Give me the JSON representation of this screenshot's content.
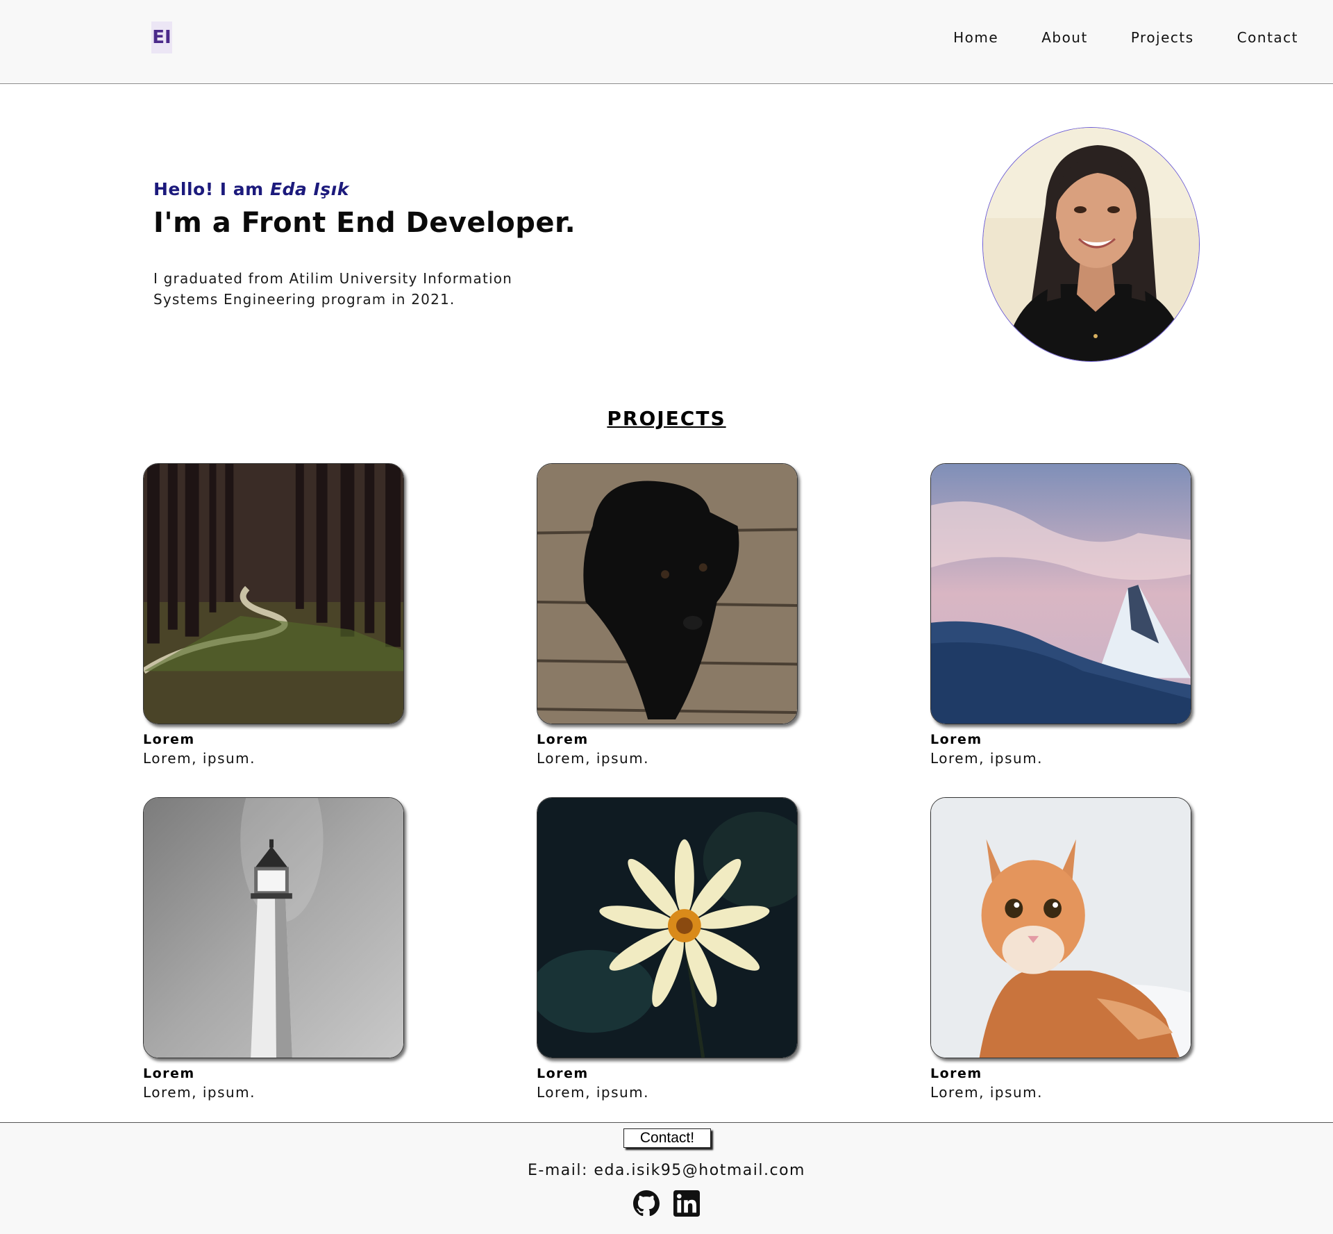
{
  "header": {
    "logo": "EI",
    "nav": [
      "Home",
      "About",
      "Projects",
      "Contact"
    ]
  },
  "hero": {
    "hello_prefix": "Hello! I am ",
    "name": "Eda Işık",
    "role": "I'm a Front End Developer.",
    "bio": "I graduated from Atilim University Information Systems Engineering program in 2021."
  },
  "projects": {
    "title": "PROJECTS",
    "items": [
      {
        "title": "Lorem",
        "desc": "Lorem, ipsum."
      },
      {
        "title": "Lorem",
        "desc": "Lorem, ipsum."
      },
      {
        "title": "Lorem",
        "desc": "Lorem, ipsum."
      },
      {
        "title": "Lorem",
        "desc": "Lorem, ipsum."
      },
      {
        "title": "Lorem",
        "desc": "Lorem, ipsum."
      },
      {
        "title": "Lorem",
        "desc": "Lorem, ipsum."
      }
    ]
  },
  "footer": {
    "contact_button": "Contact!",
    "email": "E-mail: eda.isik95@hotmail.com",
    "socials": [
      "github-icon",
      "linkedin-icon"
    ]
  },
  "colors": {
    "accent": "#1c1a7c",
    "logo": "#4b2a8a",
    "header_bg": "#f8f8f8"
  }
}
